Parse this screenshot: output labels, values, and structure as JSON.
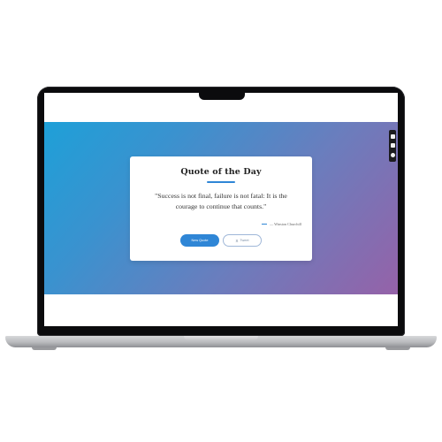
{
  "card": {
    "title": "Quote of the Day",
    "quote_line1": "\"Success is not final, failure is not fatal: It is the",
    "quote_line2": "courage to continue that counts.\"",
    "author": "— Winston Churchill"
  },
  "buttons": {
    "new_quote_label": "New Quote",
    "tweet_icon": "X",
    "tweet_label": "Tweet"
  },
  "colors": {
    "accent": "#2f86d6",
    "gradient_start": "#1ea0d8",
    "gradient_end": "#9562a8"
  },
  "icons": [
    "device-frame-icon",
    "camera-icon",
    "gear-icon"
  ]
}
